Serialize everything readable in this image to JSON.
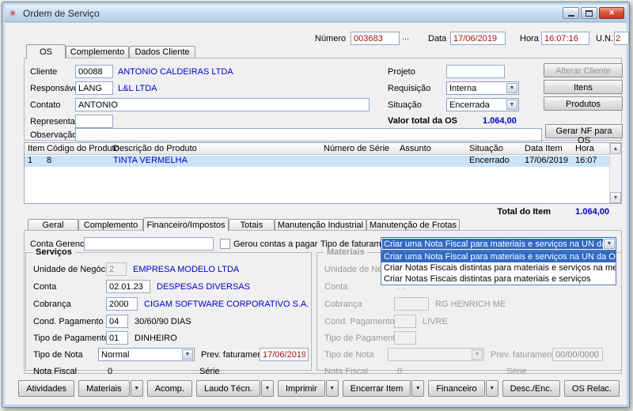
{
  "window": {
    "title": "Ordem de Serviço"
  },
  "icons": {
    "app": "✳",
    "close": "✕",
    "dropdown": "▼",
    "up": "▲",
    "down": "▼",
    "ellipsis": "..."
  },
  "colors": {
    "value_blue": "#0000cc",
    "key_red": "#a01010",
    "selection_blue": "#316ac5",
    "row_highlight": "#cbe3f8"
  },
  "header": {
    "numero_label": "Número",
    "numero_value": "003683",
    "data_label": "Data",
    "data_value": "17/06/2019",
    "hora_label": "Hora",
    "hora_value": "16:07:16",
    "un_label": "U.N.",
    "un_value": "2"
  },
  "tabs_top": {
    "os": "OS",
    "complemento": "Complemento",
    "dados_cliente": "Dados Cliente"
  },
  "form": {
    "cliente_label": "Cliente",
    "cliente_code": "00088",
    "cliente_name": "ANTONIO CALDEIRAS LTDA",
    "responsavel_label": "Responsável",
    "responsavel_code": "LANG",
    "responsavel_name": "L&L LTDA",
    "contato_label": "Contato",
    "contato_value": "ANTONIO",
    "representante_label": "Representante",
    "representante_value": "",
    "observacao_label": "Observação",
    "observacao_value": "",
    "projeto_label": "Projeto",
    "projeto_value": "",
    "requisicao_label": "Requisição",
    "requisicao_value": "Interna",
    "situacao_label": "Situação",
    "situacao_value": "Encerrada",
    "valor_total_label": "Valor total da OS",
    "valor_total_value": "1.064,00"
  },
  "side_buttons": {
    "alterar_cliente": "Alterar Cliente",
    "itens": "Itens",
    "produtos": "Produtos",
    "gerar_nf": "Gerar NF para OS"
  },
  "grid": {
    "headers": [
      "Item",
      "Código do Produto",
      "Descrição do Produto",
      "Número de Série",
      "Assunto",
      "Situação",
      "Data Item",
      "Hora"
    ],
    "row": {
      "item": "1",
      "codigo": "8",
      "descricao": "TINTA VERMELHA",
      "numero_serie": "",
      "assunto": "",
      "situacao": "Encerrado",
      "data_item": "17/06/2019",
      "hora": "16:07"
    },
    "total_label": "Total do Item",
    "total_value": "1.064,00"
  },
  "tabs_bottom": {
    "geral": "Geral",
    "complemento": "Complemento",
    "financeiro": "Financeiro/Impostos",
    "totais": "Totais",
    "manut_industrial": "Manutenção Industrial",
    "manut_frotas": "Manutenção de Frotas"
  },
  "financeiro": {
    "conta_gerencial_label": "Conta Gerencial",
    "conta_gerencial_value": "",
    "gerou_contas_label": "Gerou contas a pagar",
    "tipo_faturamento_label": "Tipo de faturamento",
    "tipo_faturamento_value": "Criar uma Nota Fiscal para materiais e serviços na UN da OS",
    "dropdown_options": [
      "Criar uma Nota Fiscal para materiais e serviços na UN da OS",
      "Criar Notas Fiscais distintas para materiais e serviços na mesma UN",
      "Criar Notas Fiscais distintas para materiais e serviços"
    ],
    "servicos": {
      "title": "Serviços",
      "un_label": "Unidade de Negócio",
      "un_code": "2",
      "un_name": "EMPRESA MODELO LTDA",
      "conta_label": "Conta",
      "conta_code": "02.01.23",
      "conta_name": "DESPESAS DIVERSAS",
      "cobranca_label": "Cobrança",
      "cobranca_code": "2000",
      "cobranca_name": "CIGAM SOFTWARE CORPORATIVO S.A.",
      "cond_pagamento_label": "Cond. Pagamento",
      "cond_pagamento_code": "04",
      "cond_pagamento_name": "30/60/90 DIAS",
      "tipo_pagamento_label": "Tipo de Pagamento",
      "tipo_pagamento_code": "01",
      "tipo_pagamento_name": "DINHEIRO",
      "tipo_nota_label": "Tipo de Nota",
      "tipo_nota_value": "Normal",
      "prev_faturamento_label": "Prev. faturamento",
      "prev_faturamento_value": "17/06/2019",
      "nota_fiscal_label": "Nota Fiscal",
      "nota_fiscal_value": "0",
      "serie_label": "Série"
    },
    "materiais": {
      "title": "Materiais",
      "un_label": "Unidade de Negóc",
      "conta_label": "Conta",
      "conta_value": ". .",
      "cobranca_label": "Cobrança",
      "cobranca_value": "",
      "cobranca_name": "RG HENRICH ME",
      "cond_pagamento_label": "Cond. Pagamento",
      "cond_pagamento_value": "",
      "cond_pagamento_name": "LIVRE",
      "tipo_pagamento_label": "Tipo de Pagamento",
      "tipo_pagamento_value": "",
      "tipo_nota_label": "Tipo de Nota",
      "tipo_nota_value": "",
      "prev_faturamento_label": "Prev. faturamento",
      "prev_faturamento_value": "00/00/0000",
      "nota_fiscal_label": "Nota Fiscal",
      "nota_fiscal_value": "0",
      "serie_label": "Série"
    }
  },
  "bottom_buttons": {
    "atividades": "Atividades",
    "materiais": "Materiais",
    "acomp": "Acomp.",
    "laudo": "Laudo Técn.",
    "imprimir": "Imprimir",
    "encerrar": "Encerrar Item",
    "financeiro": "Financeiro",
    "desc_enc": "Desc./Enc.",
    "os_relac": "OS Relac."
  }
}
